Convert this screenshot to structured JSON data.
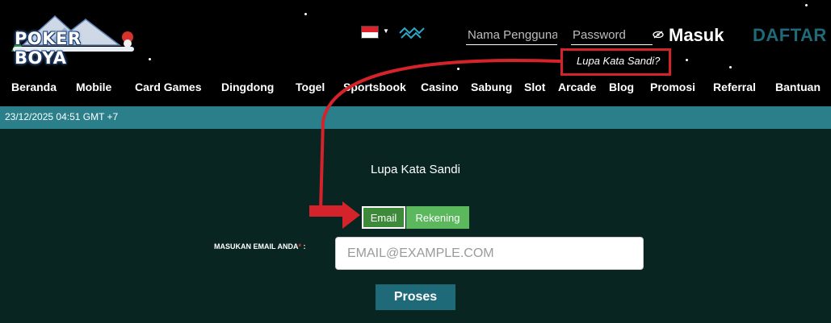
{
  "brand": {
    "logo_text": "POKER BOYA"
  },
  "header": {
    "language_flag": "indonesia-flag-icon",
    "username_placeholder": "Nama Pengguna",
    "password_placeholder": "Password",
    "login_label": "Masuk",
    "register_label": "DAFTAR",
    "forgot_link": "Lupa Kata Sandi?"
  },
  "nav": {
    "items": [
      {
        "label": "Beranda"
      },
      {
        "label": "Mobile"
      },
      {
        "label": "Card Games"
      },
      {
        "label": "Dingdong"
      },
      {
        "label": "Togel"
      },
      {
        "label": "Sportsbook"
      },
      {
        "label": "Casino"
      },
      {
        "label": "Sabung"
      },
      {
        "label": "Slot"
      },
      {
        "label": "Arcade"
      },
      {
        "label": "Blog"
      },
      {
        "label": "Promosi"
      },
      {
        "label": "Referral"
      },
      {
        "label": "Bantuan"
      }
    ]
  },
  "datebar": {
    "datetime": "23/12/2025 04:51 GMT +7"
  },
  "form": {
    "title": "Lupa Kata Sandi",
    "tabs": [
      {
        "label": "Email",
        "active": true
      },
      {
        "label": "Rekening",
        "active": false
      }
    ],
    "email_label": "MASUKAN EMAIL ANDA",
    "email_required_mark": "*",
    "email_label_suffix": " :",
    "email_placeholder": "EMAIL@EXAMPLE.COM",
    "submit_label": "Proses"
  },
  "colors": {
    "background": "#000000",
    "content_bg": "#082522",
    "accent_teal": "#1e6a78",
    "datebar": "#2a7f8a",
    "annotation_red": "#d4232b",
    "tab_active": "#3d8a3a",
    "tab_inactive": "#5cb85c"
  }
}
